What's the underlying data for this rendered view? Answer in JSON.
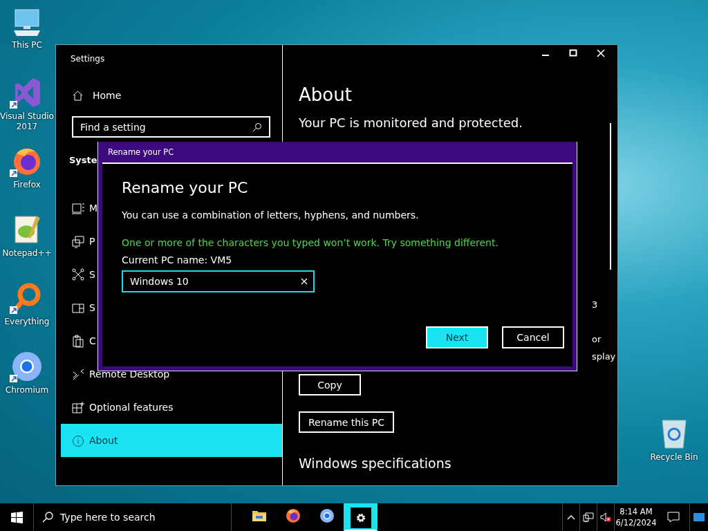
{
  "desktop_icons": [
    {
      "kind": "pc",
      "label": "This PC",
      "shortcut": false
    },
    {
      "kind": "vs",
      "label": "Visual Studio 2017",
      "shortcut": true
    },
    {
      "kind": "firefox",
      "label": "Firefox",
      "shortcut": true
    },
    {
      "kind": "notepad",
      "label": "Notepad++",
      "shortcut": false
    },
    {
      "kind": "everything",
      "label": "Everything",
      "shortcut": true
    },
    {
      "kind": "chromium",
      "label": "Chromium",
      "shortcut": true
    }
  ],
  "recycle_bin": {
    "label": "Recycle Bin"
  },
  "settings_window": {
    "title": "Settings",
    "sidebar": {
      "home": "Home",
      "search": {
        "placeholder": "Find a setting"
      },
      "section": "Syste",
      "items": [
        {
          "kind": "multitasking",
          "label": "M",
          "selected": false
        },
        {
          "kind": "projecting",
          "label": "P",
          "selected": false
        },
        {
          "kind": "shared",
          "label": "S",
          "selected": false
        },
        {
          "kind": "split",
          "label": "S",
          "selected": false
        },
        {
          "kind": "clipboard",
          "label": "C",
          "selected": false
        },
        {
          "kind": "remote",
          "label": "Remote Desktop",
          "selected": false
        },
        {
          "kind": "features",
          "label": "Optional features",
          "selected": false
        },
        {
          "kind": "info",
          "label": "About",
          "selected": true
        }
      ]
    },
    "content": {
      "heading": "About",
      "status": "Your PC is monitored and protected.",
      "partial_texts": [
        "3",
        "or",
        "splay"
      ],
      "buttons": [
        "Copy",
        "Rename this PC"
      ],
      "section": "Windows specifications"
    }
  },
  "dialog": {
    "title": "Rename your PC",
    "heading": "Rename your PC",
    "description": "You can use a combination of letters, hyphens, and numbers.",
    "error": "One or more of the characters you typed won’t work. Try something different.",
    "current_name": "Current PC name: VM5",
    "name_field": {
      "value": "Windows 10"
    },
    "buttons": [
      {
        "label": "Next",
        "primary": true
      },
      {
        "label": "Cancel",
        "primary": false
      }
    ]
  },
  "taskbar": {
    "search": {
      "placeholder": "Type here to search"
    },
    "apps": [
      {
        "kind": "folder",
        "selected": false
      },
      {
        "kind": "firefox",
        "selected": false
      },
      {
        "kind": "chromium",
        "selected": false
      },
      {
        "kind": "settings",
        "selected": true
      }
    ],
    "clock": {
      "time": "8:14 AM",
      "date": "6/12/2024"
    }
  }
}
